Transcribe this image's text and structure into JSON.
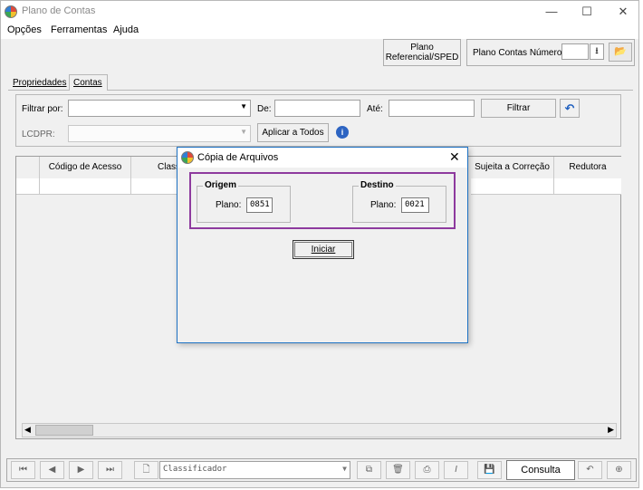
{
  "window": {
    "title": "Plano de Contas",
    "minimize": "—",
    "maximize": "☐",
    "close": "✕"
  },
  "menu": [
    "Opções",
    "Ferramentas",
    "Ajuda"
  ],
  "toolbar": {
    "plano_ref_line1": "Plano",
    "plano_ref_line2": "Referencial/SPED",
    "numero_label": "Plano Contas Número",
    "numero_value": ""
  },
  "tabs": [
    {
      "label": "Propriedades",
      "active": false
    },
    {
      "label": "Contas",
      "active": true
    }
  ],
  "filter": {
    "filtrar_por_label": "Filtrar por:",
    "filtrar_por_value": "",
    "de_label": "De:",
    "de_value": "",
    "ate_label": "Até:",
    "ate_value": "",
    "filtrar_button": "Filtrar",
    "lcdpr_label": "LCDPR:",
    "lcdpr_value": "",
    "aplicar_button": "Aplicar a Todos"
  },
  "grid": {
    "columns": [
      "",
      "Código de Acesso",
      "Class",
      "Sujeita a Correção",
      "Redutora"
    ]
  },
  "dialog": {
    "title": "Cópia de Arquivos",
    "origem": {
      "legend": "Origem",
      "plano_label": "Plano:",
      "plano_value": "0851"
    },
    "destino": {
      "legend": "Destino",
      "plano_label": "Plano:",
      "plano_value": "0021"
    },
    "iniciar_button": "Iniciar",
    "highlight_color": "#8e3a9e"
  },
  "bottom": {
    "classificador_value": "Classificador",
    "consulta_label": "Consulta"
  }
}
